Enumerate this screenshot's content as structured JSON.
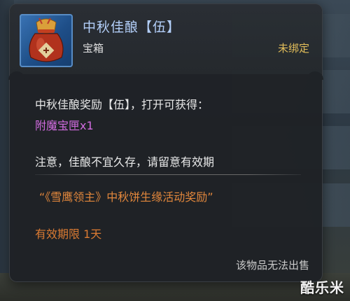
{
  "item": {
    "name": "中秋佳酿【伍】",
    "type": "宝箱",
    "bind_status": "未绑定",
    "icon": "wine-jar-icon"
  },
  "description": {
    "reward_line": "中秋佳酿奖励【伍】，打开可获得：",
    "reward_item": "附魔宝匣x1",
    "note": "注意，佳酿不宜久存，请留意有效期",
    "source": "“《雪鹰领主》中秋饼生缘活动奖励”",
    "expiry": "有效期限 1天",
    "sell_status": "该物品无法出售"
  },
  "watermark": "酷乐米",
  "colors": {
    "title": "#b7d4ff",
    "bind": "#e7c15a",
    "reward_item": "#d86ee6",
    "source": "#e88a3c",
    "expiry": "#e07d32"
  }
}
